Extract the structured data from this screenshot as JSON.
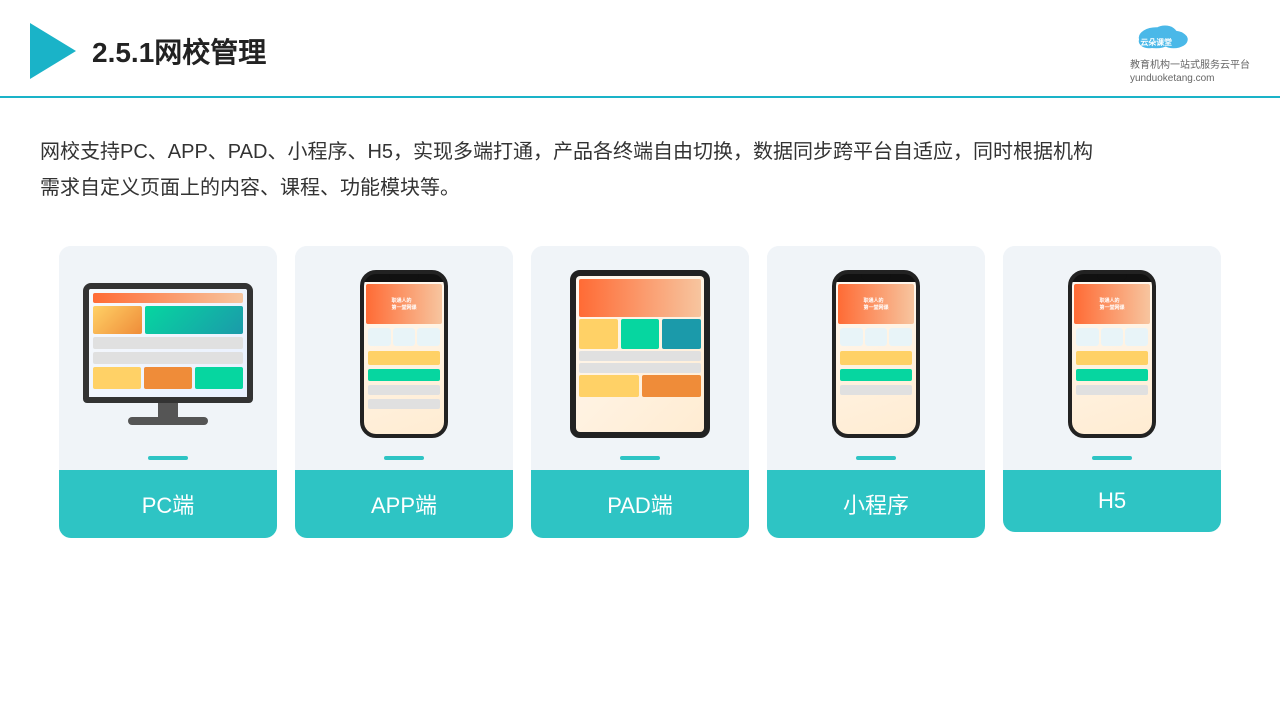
{
  "header": {
    "section_number": "2.5.1",
    "title": "网校管理",
    "brand_name": "云朵课堂",
    "brand_url": "yunduoketang.com",
    "brand_tagline": "教育机构一站式服务云平台"
  },
  "description": {
    "text": "网校支持PC、APP、PAD、小程序、H5，实现多端打通，产品各终端自由切换，数据同步跨平台自适应，同时根据机构需求自定义页面上的内容、课程、功能模块等。"
  },
  "cards": [
    {
      "id": "pc",
      "label": "PC端"
    },
    {
      "id": "app",
      "label": "APP端"
    },
    {
      "id": "pad",
      "label": "PAD端"
    },
    {
      "id": "miniprogram",
      "label": "小程序"
    },
    {
      "id": "h5",
      "label": "H5"
    }
  ],
  "colors": {
    "accent": "#2ec4c4",
    "header_line": "#1ab3c8",
    "card_bg": "#f0f4f8",
    "card_label_bg": "#2ec4c4"
  }
}
